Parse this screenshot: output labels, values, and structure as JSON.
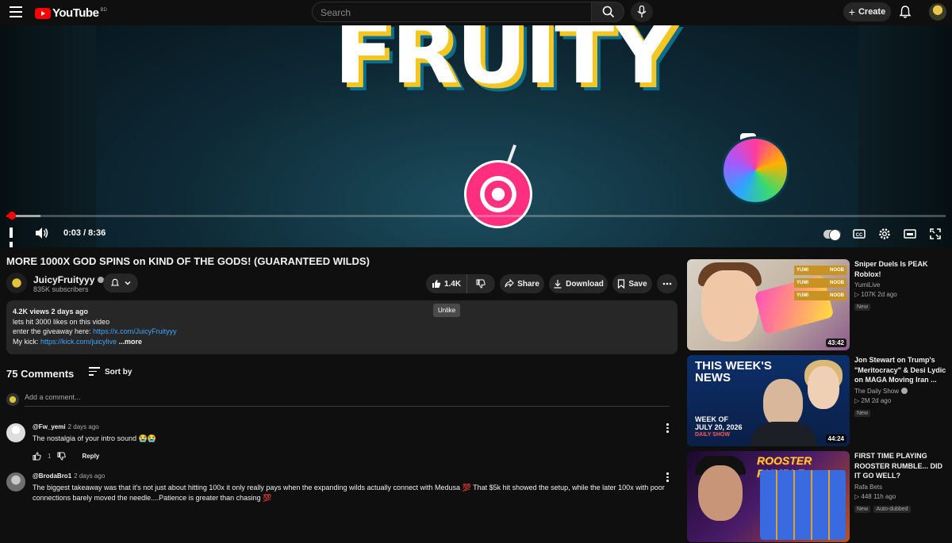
{
  "header": {
    "logo_text": "YouTube",
    "country_code": "BD",
    "search_placeholder": "Search",
    "create_label": "Create"
  },
  "player": {
    "thumbnail_text": "FRUITY",
    "current_time": "0:03",
    "duration": "8:36",
    "time_display": "0:03 / 8:36",
    "played_fraction": 0.006,
    "buffered_fraction": 0.036,
    "tooltip": "Unlike"
  },
  "video": {
    "title": "MORE 1000X GOD SPINS on KIND OF THE GODS! (GUARANTEED WILDS)",
    "channel_name": "JuicyFruityyy",
    "subscribers": "835K subscribers",
    "likes": "1.4K",
    "share_label": "Share",
    "download_label": "Download",
    "save_label": "Save"
  },
  "description": {
    "meta": "4.2K views  2 days ago",
    "line1": "lets hit 3000 likes on this video",
    "line2_prefix": "enter the giveaway here: ",
    "line2_link": "https://x.com/JuicyFruityyy",
    "line3_prefix": "My kick: ",
    "line3_link": "https://kick.com/juicylive",
    "more": "...more"
  },
  "comments": {
    "count_label": "75 Comments",
    "sort_label": "Sort by",
    "add_placeholder": "Add a comment...",
    "items": [
      {
        "user": "@Fw_yemi",
        "time": "2 days ago",
        "text": "The nostalgia of your intro sound 😭😭",
        "likes": "1",
        "reply": "Reply"
      },
      {
        "user": "@BrodaBro1",
        "time": "2 days ago",
        "text": "The biggest takeaway was that it's not just about hitting 100x it only really pays when the expanding wilds actually connect with Medusa 💯 That $5k hit showed the setup, while the later 100x with poor connections barely moved the needle....Patience is greater than chasing 💯"
      }
    ]
  },
  "recommendations": [
    {
      "title": "Sniper Duels Is PEAK Roblox!",
      "channel": "YumiLive",
      "stats": "▷ 107K  2d ago",
      "badge": "New",
      "duration": "43:42",
      "thumb_tags": [
        "YUMI",
        "NOOB"
      ]
    },
    {
      "title": "Jon Stewart on Trump's \"Meritocracy\" & Desi Lydic on MAGA Moving Iran ...",
      "channel": "The Daily Show",
      "stats": "▷ 2M  2d ago",
      "badge": "New",
      "duration": "44:24",
      "thumb_line1": "THIS WEEK'S",
      "thumb_line2": "NEWS",
      "thumb_week1": "WEEK OF",
      "thumb_week2": "JULY 20, 2026",
      "thumb_show": "DAILY SHOW"
    },
    {
      "title": "FIRST TIME PLAYING ROOSTER RUMBLE... DID IT GO WELL?",
      "channel": "Rafa Bets",
      "stats": "▷ 448  11h ago",
      "badge": "New",
      "badge2": "Auto-dubbed",
      "thumb_text": "ROOSTER RUMBLE"
    }
  ],
  "colors": {
    "background": "#0f0f0f",
    "accent_red": "#ff0000",
    "link_blue": "#3ea6ff",
    "chip_bg": "#272727"
  }
}
